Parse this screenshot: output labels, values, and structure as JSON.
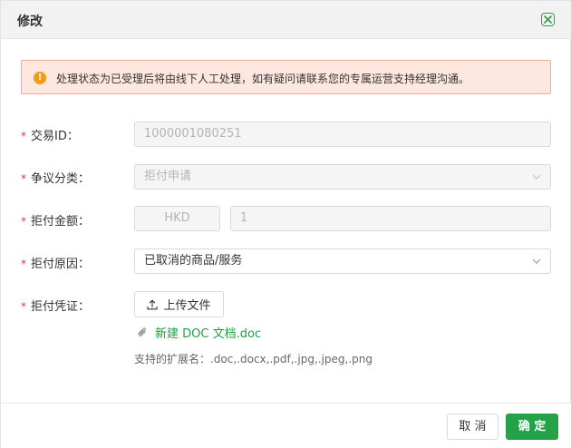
{
  "dialog": {
    "title": "修改"
  },
  "alert": {
    "icon": "warning-icon",
    "text": "处理状态为已受理后将由线下人工处理，如有疑问请联系您的专属运营支持经理沟通。"
  },
  "form": {
    "required_mark": "*",
    "transaction_id": {
      "label": "交易ID：",
      "value": "1000001080251"
    },
    "dispute_type": {
      "label": "争议分类：",
      "value": "拒付申请"
    },
    "chargeback_amount": {
      "label": "拒付金额：",
      "currency": "HKD",
      "amount": "1"
    },
    "chargeback_reason": {
      "label": "拒付原因：",
      "value": "已取消的商品/服务"
    },
    "chargeback_proof": {
      "label": "拒付凭证：",
      "upload_label": "上传文件",
      "file_name": "新建 DOC 文档.doc",
      "ext_hint": "支持的扩展名：.doc,.docx,.pdf,.jpg,.jpeg,.png"
    }
  },
  "footer": {
    "cancel_label": "取 消",
    "ok_label": "确 定"
  },
  "colors": {
    "accent": "#25a148",
    "warning": "#f39b16",
    "alert_bg": "#fde7de",
    "required": "#e5383b"
  }
}
